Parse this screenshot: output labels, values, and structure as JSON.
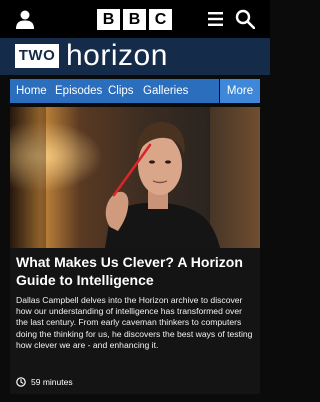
{
  "header": {
    "logo_letters": [
      "B",
      "B",
      "C"
    ],
    "icons": [
      "account-icon",
      "menu-icon",
      "search-icon"
    ]
  },
  "brand": {
    "channel_badge": "TWO",
    "programme_title": "horizon",
    "colors": {
      "brand_bar": "#142b4a",
      "nav_bar": "#2a6ebd",
      "nav_more": "#3f88d9"
    }
  },
  "nav": {
    "items": [
      {
        "label": "Home"
      },
      {
        "label": "Episodes"
      },
      {
        "label": "Clips"
      },
      {
        "label": "Galleries"
      }
    ],
    "more_label": "More"
  },
  "episode": {
    "title": "What Makes Us Clever? A Horizon Guide to Intelligence",
    "description": "Dallas Campbell delves into the Horizon archive to discover how our understanding of intelligence has transformed over the last century. From early caveman thinkers to computers doing the thinking for us, he discovers the best ways of testing how clever we are - and enhancing it.",
    "duration": "59 minutes"
  }
}
